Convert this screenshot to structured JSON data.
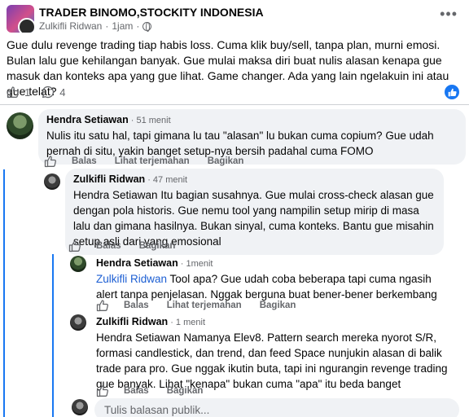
{
  "post": {
    "group_name": "TRADER BINOMO,STOCKITY INDONESIA",
    "author": "Zulkifli Ridwan",
    "time": "1jam",
    "separator": "·",
    "body": "Gue dulu revenge trading tiap habis loss. Cuma klik buy/sell, tanpa plan, murni emosi. Bulan lalu gue kehilangan banyak. Gue mulai maksa diri buat nulis alasan kenapa gue masuk dan konteks apa yang gue lihat. Game changer. Ada yang lain ngelakuin ini atau gue telat?",
    "like_count": "1",
    "comment_count": "4",
    "more": "•••"
  },
  "actions": {
    "reply": "Balas",
    "translate": "Lihat terjemahan",
    "share": "Bagikan"
  },
  "comments": [
    {
      "author": "Hendra Setiawan",
      "time": "· 51 menit",
      "text": "Nulis itu satu hal, tapi gimana lu tau \"alasan\" lu bukan cuma copium? Gue udah pernah di situ, yakin banget setup-nya bersih padahal cuma FOMO"
    },
    {
      "author": "Zulkifli Ridwan",
      "time": "· 47 menit",
      "text": "Hendra Setiawan Itu bagian susahnya. Gue mulai cross-check alasan gue dengan pola historis. Gue nemu tool yang nampilin setup mirip di masa lalu dan gimana hasilnya. Bukan sinyal, cuma konteks. Bantu gue misahin setup asli dari yang emosional"
    },
    {
      "author": "Hendra Setiawan",
      "time": "· 1menit",
      "mention": "Zulkifli Ridwan",
      "text": " Tool apa? Gue udah coba beberapa tapi cuma ngasih alert tanpa penjelasan. Nggak berguna buat bener-bener berkembang"
    },
    {
      "author": "Zulkifli Ridwan",
      "time": "· 1 menit",
      "text": "Hendra Setiawan Namanya Elev8. Pattern search mereka nyorot S/R, formasi candlestick, dan trend, dan feed Space nunjukin alasan di balik trade para pro. Gue nggak ikutin buta, tapi ini ngurangin revenge trading gue banyak. Lihat \"kenapa\" bukan cuma \"apa\" itu beda banget"
    }
  ],
  "reply_box": {
    "placeholder": "Tulis balasan publik..."
  },
  "colors": {
    "accent": "#1877f2",
    "bubble": "#f0f2f5",
    "muted": "#65676b"
  }
}
